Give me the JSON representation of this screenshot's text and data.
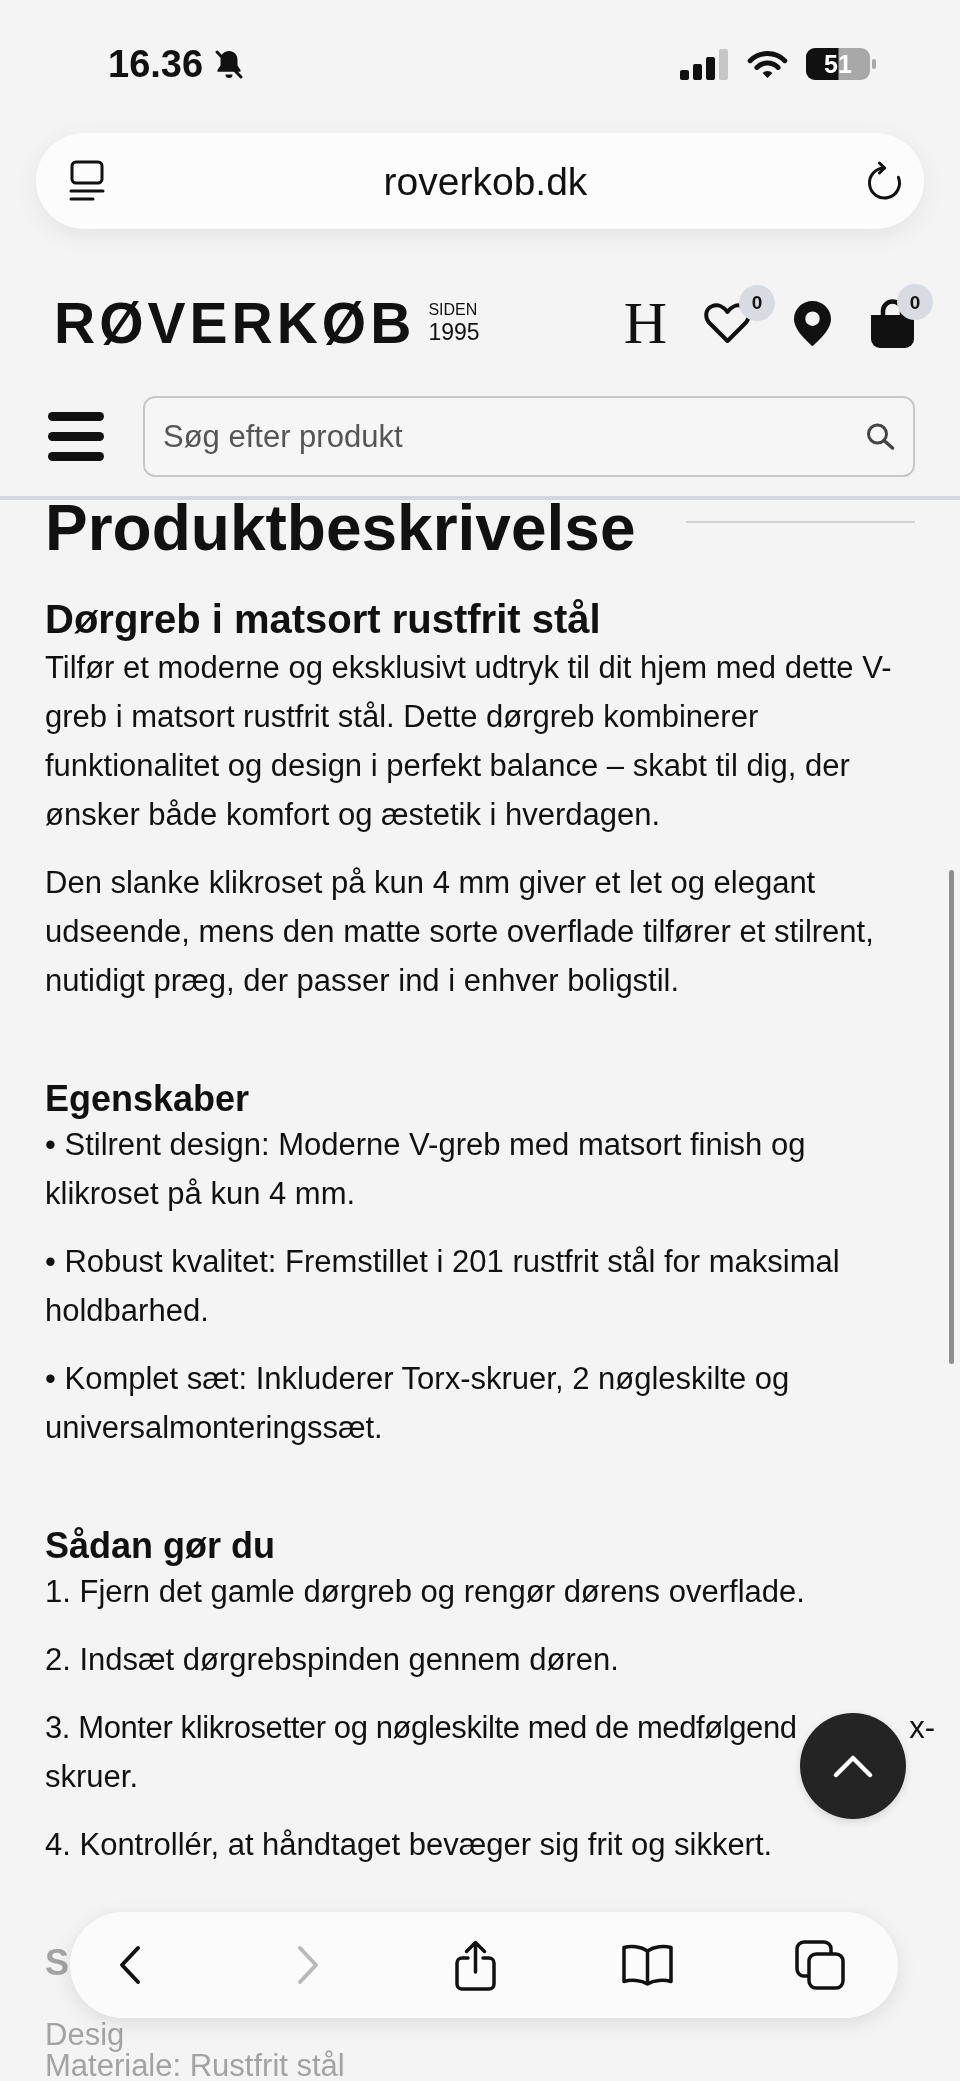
{
  "status_bar": {
    "time": "16.36",
    "battery": "51"
  },
  "address_bar": {
    "url": "roverkob.dk"
  },
  "header": {
    "logo": "RØVERKØB",
    "tagline": [
      "SIDEN",
      "1995"
    ],
    "actions": [
      {
        "kind": "letter",
        "label": "H"
      },
      {
        "kind": "heart",
        "badge": "0"
      },
      {
        "kind": "pin"
      },
      {
        "kind": "bag",
        "badge": "0"
      }
    ]
  },
  "search": {
    "placeholder": "Søg efter produkt"
  },
  "article": {
    "title": "Produktbeskrivelse",
    "sections": [
      {
        "kind": "lead",
        "heading": "Dørgreb i matsort rustfrit stål",
        "paragraphs": [
          {
            "kind": "text",
            "text": "Tilfør et moderne og eksklusivt udtryk til dit hjem med dette V-greb i matsort rustfrit stål. Dette dørgreb kombinerer funktionalitet og design i perfekt balance – skabt til dig, der ønsker både komfort og æstetik i hverdagen."
          },
          {
            "kind": "text",
            "text": "Den slanke klikroset på kun 4 mm giver et let og elegant udseende, mens den matte sorte overflade tilfører et stilrent, nutidigt præg, der passer ind i enhver boligstil."
          }
        ]
      },
      {
        "kind": "normal",
        "heading": "Egenskaber",
        "paragraphs": [
          {
            "kind": "text",
            "text": "• Stilrent design: Moderne V-greb med matsort finish og klikroset på kun 4 mm."
          },
          {
            "kind": "text",
            "text": "• Robust kvalitet: Fremstillet i 201 rustfrit stål for maksimal holdbarhed."
          },
          {
            "kind": "text",
            "text": "• Komplet sæt: Inkluderer Torx-skruer, 2 nøgleskilte og universalmonteringssæt."
          }
        ]
      },
      {
        "kind": "normal",
        "heading": "Sådan gør du",
        "paragraphs": [
          {
            "kind": "text",
            "text": "1. Fjern det gamle dørgreb og rengør dørens overflade."
          },
          {
            "kind": "text",
            "text": "2. Indsæt dørgrebspinden gennem døren."
          },
          {
            "kind": "covered",
            "parts": [
              "3. Monter klikrosetter og nøgleskilte med de medfølgend",
              "x-",
              "skruer."
            ]
          },
          {
            "kind": "text",
            "text": "4. Kontrollér, at håndtaget bevæger sig frit og sikkert."
          }
        ]
      },
      {
        "kind": "faded",
        "heading": "S",
        "paragraphs": [
          {
            "kind": "text",
            "text": "Desig"
          },
          {
            "kind": "text",
            "text": "Materiale: Rustfrit stål"
          }
        ]
      }
    ]
  },
  "bottom_toolbar": {
    "buttons": [
      {
        "kind": "back",
        "disabled": false
      },
      {
        "kind": "forward",
        "disabled": true
      },
      {
        "kind": "share",
        "disabled": false
      },
      {
        "kind": "bookmarks",
        "disabled": false
      },
      {
        "kind": "tabs",
        "disabled": false
      }
    ]
  }
}
